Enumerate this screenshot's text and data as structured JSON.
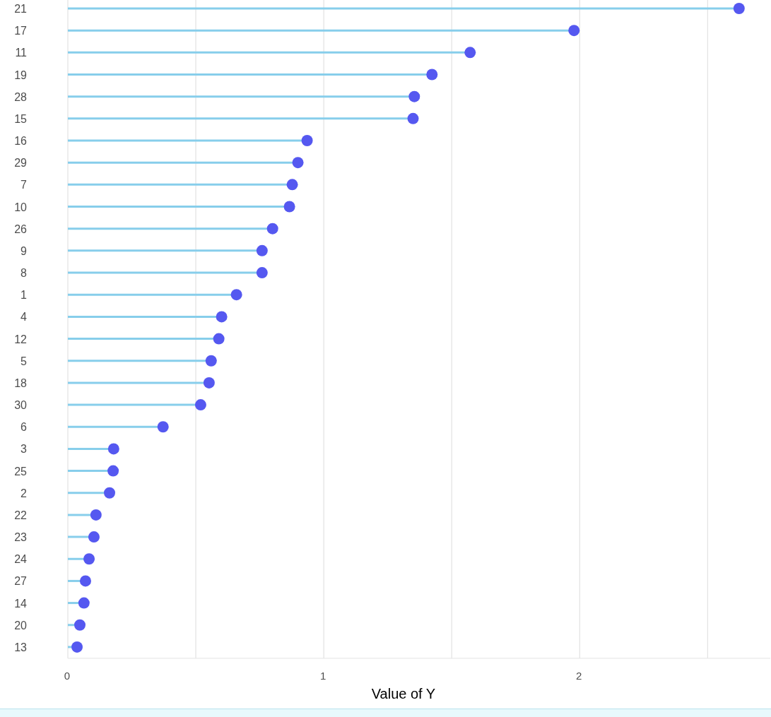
{
  "chart": {
    "chart_data": {
      "type": "scatter",
      "orientation": "horizontal",
      "xlabel": "Value of Y",
      "categories": [
        "21",
        "17",
        "11",
        "19",
        "28",
        "15",
        "16",
        "29",
        "7",
        "10",
        "26",
        "9",
        "8",
        "1",
        "4",
        "12",
        "5",
        "18",
        "30",
        "6",
        "3",
        "25",
        "2",
        "22",
        "23",
        "24",
        "27",
        "14",
        "20",
        "13"
      ],
      "series": [
        {
          "color": "#5558f0",
          "values": [
            2.623,
            1.978,
            1.572,
            1.423,
            1.354,
            1.349,
            0.935,
            0.899,
            0.877,
            0.866,
            0.8,
            0.759,
            0.759,
            0.659,
            0.601,
            0.59,
            0.56,
            0.552,
            0.519,
            0.372,
            0.179,
            0.177,
            0.163,
            0.11,
            0.102,
            0.083,
            0.069,
            0.063,
            0.047,
            0.036
          ]
        }
      ],
      "xlim": [
        0,
        2.745
      ],
      "xticks": [
        0,
        1,
        2
      ]
    }
  }
}
